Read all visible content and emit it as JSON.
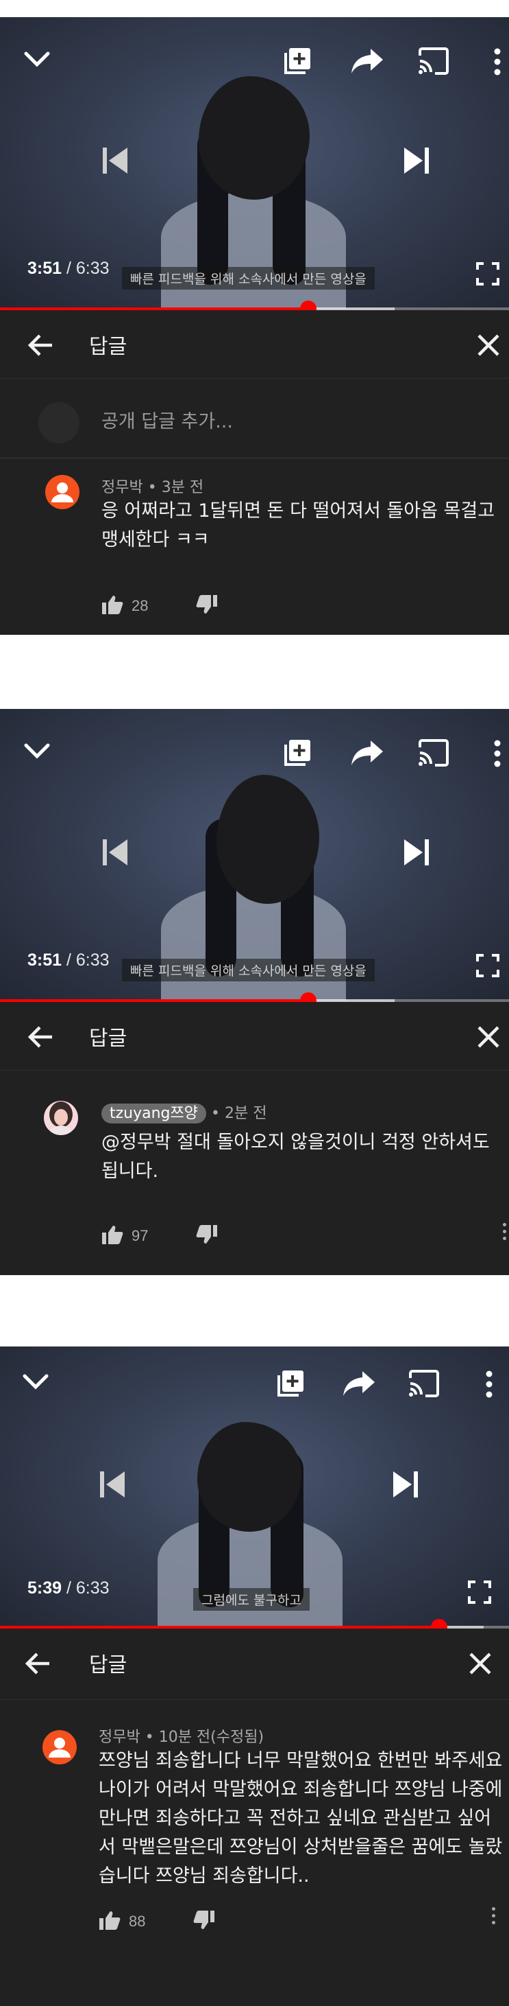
{
  "screens": [
    {
      "header_title": "답글",
      "time_current": "3:51",
      "time_separator": "/",
      "time_duration": "6:33",
      "caption": "빠른 피드백을 위해 소속사에서 만든 영상을",
      "progress": {
        "played": 0.605,
        "buffered": 0.775
      },
      "reply_placeholder": "공개 답글 추가...",
      "comment": {
        "author": "정무박",
        "age": "• 3분 전",
        "text": "응 어쩌라고 1달뒤면 돈 다 떨어져서 돌아옴 목걸고\n맹세한다 ㅋㅋ",
        "likes": "28"
      }
    },
    {
      "header_title": "답글",
      "time_current": "3:51",
      "time_separator": "/",
      "time_duration": "6:33",
      "caption": "빠른 피드백을 위해 소속사에서 만든 영상을",
      "progress": {
        "played": 0.605,
        "buffered": 0.775
      },
      "comment": {
        "author": "tzuyang쯔양",
        "age": "• 2분 전",
        "text": "@정무박 절대 돌아오지 않을것이니 걱정 안하셔도\n됩니다.",
        "likes": "97"
      }
    },
    {
      "header_title": "답글",
      "time_current": "5:39",
      "time_separator": "/",
      "time_duration": "6:33",
      "caption": "그럼에도 불구하고",
      "progress": {
        "played": 0.863,
        "buffered": 0.95
      },
      "comment": {
        "author": "정무박",
        "age": "• 10분 전(수정됨)",
        "text": "쯔양님 죄송합니다 너무 막말했어요 한번만 봐주세요\n나이가 어려서 막말했어요 죄송합니다 쯔양님 나중에\n만나면 죄송하다고 꼭 전하고 싶네요 관심받고 싶어\n서 막뱉은말은데 쯔양님이 상처받을줄은 꿈에도 놀랐\n습니다 쯔양님 죄송합니다..",
        "likes": "88"
      }
    }
  ],
  "icons": {
    "collapse": "chevron-down-icon",
    "add_to_playlist": "playlist-add-icon",
    "share": "share-icon",
    "cast": "cast-icon",
    "more": "more-vert-icon",
    "previous": "skip-previous-icon",
    "next": "skip-next-icon",
    "fullscreen": "fullscreen-icon",
    "back": "arrow-back-icon",
    "close": "close-icon",
    "like": "thumbs-up-icon",
    "dislike": "thumbs-down-icon"
  },
  "colors": {
    "accent": "#ff0000",
    "avatar_orange": "#f4511e",
    "panel_bg": "#212121"
  }
}
